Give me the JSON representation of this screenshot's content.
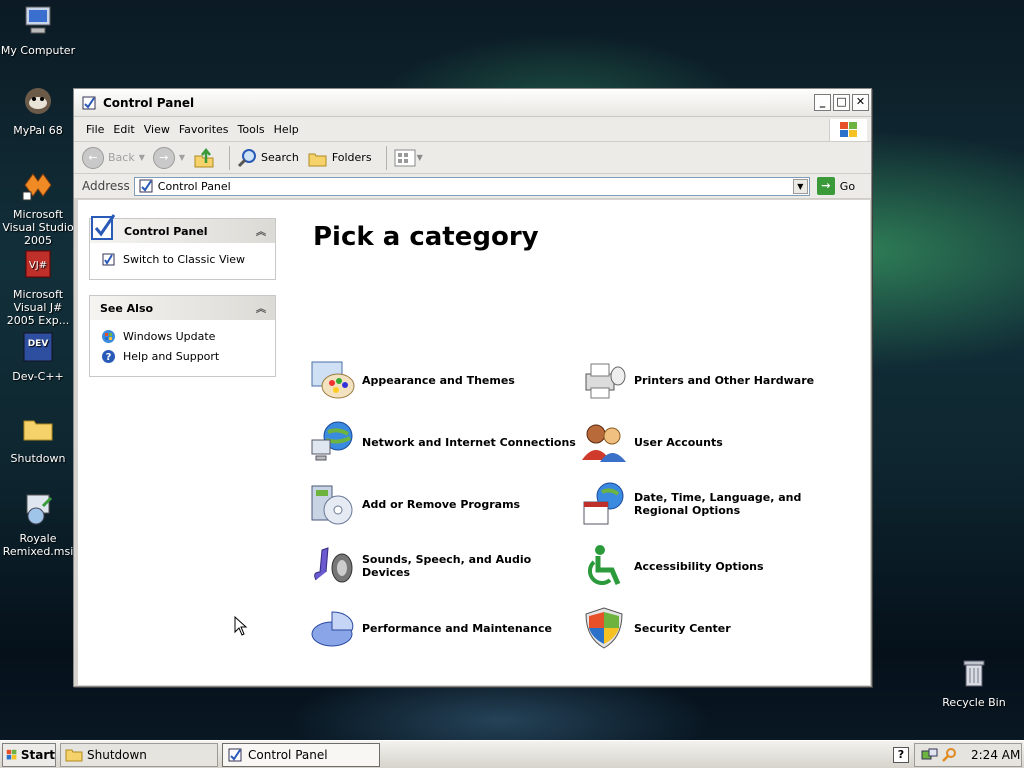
{
  "desktop": {
    "icons": [
      {
        "label": "My Computer",
        "icon": "computer-icon"
      },
      {
        "label": "MyPal 68",
        "icon": "mypal-icon"
      },
      {
        "label": "Microsoft Visual Studio 2005",
        "icon": "visual-studio-icon"
      },
      {
        "label": "Microsoft Visual J# 2005 Exp...",
        "icon": "visual-jsharp-icon"
      },
      {
        "label": "Dev-C++",
        "icon": "devcpp-icon"
      },
      {
        "label": "Shutdown",
        "icon": "folder-icon"
      },
      {
        "label": "Royale Remixed.msi",
        "icon": "installer-icon"
      },
      {
        "label": "Recycle Bin",
        "icon": "recycle-bin-icon"
      }
    ]
  },
  "window": {
    "title": "Control Panel",
    "menu": [
      "File",
      "Edit",
      "View",
      "Favorites",
      "Tools",
      "Help"
    ],
    "toolbar": {
      "back": "Back",
      "search": "Search",
      "folders": "Folders"
    },
    "address": {
      "label": "Address",
      "value": "Control Panel",
      "go": "Go"
    }
  },
  "taskpane": {
    "control_panel": {
      "title": "Control Panel",
      "items": [
        "Switch to Classic View"
      ]
    },
    "see_also": {
      "title": "See Also",
      "items": [
        "Windows Update",
        "Help and Support"
      ]
    }
  },
  "main": {
    "heading": "Pick a category",
    "categories": [
      {
        "label": "Appearance and Themes",
        "icon": "appearance-icon"
      },
      {
        "label": "Printers and Other Hardware",
        "icon": "printer-icon"
      },
      {
        "label": "Network and Internet Connections",
        "icon": "network-icon"
      },
      {
        "label": "User Accounts",
        "icon": "user-accounts-icon"
      },
      {
        "label": "Add or Remove Programs",
        "icon": "add-remove-icon"
      },
      {
        "label": "Date, Time, Language, and Regional Options",
        "icon": "date-time-icon"
      },
      {
        "label": "Sounds, Speech, and Audio Devices",
        "icon": "sounds-icon"
      },
      {
        "label": "Accessibility Options",
        "icon": "accessibility-icon"
      },
      {
        "label": "Performance and Maintenance",
        "icon": "performance-icon"
      },
      {
        "label": "Security Center",
        "icon": "security-shield-icon"
      }
    ]
  },
  "taskbar": {
    "start": "Start",
    "tasks": [
      "Shutdown",
      "Control Panel"
    ],
    "clock": "2:24 AM"
  },
  "colors": {
    "accent_blue": "#2a5ab8",
    "link_green": "#3a9a3a"
  }
}
